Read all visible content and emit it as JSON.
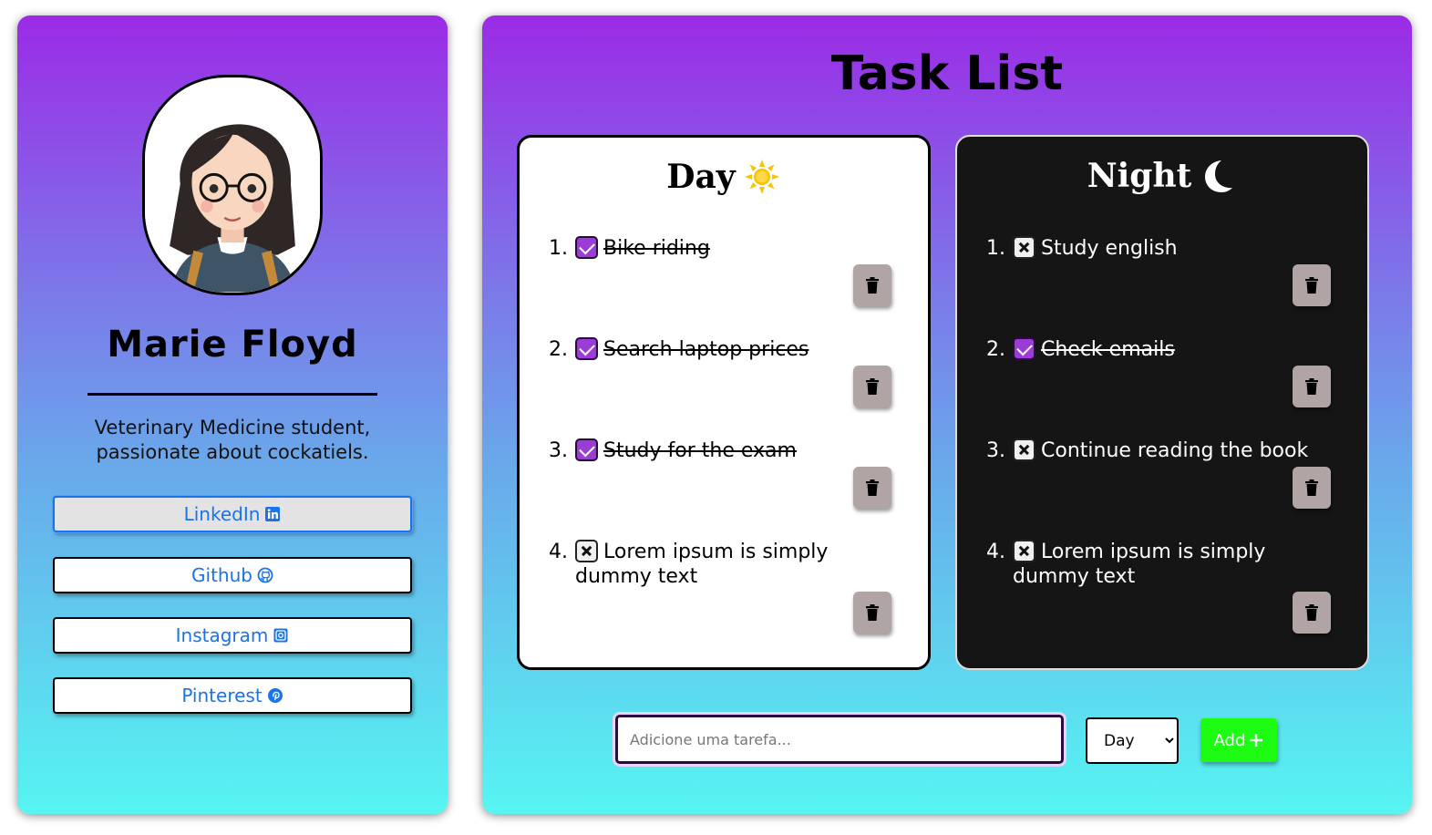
{
  "profile": {
    "name": "Marie Floyd",
    "bio_line1": "Veterinary Medicine student,",
    "bio_line2": "passionate about cockatiels.",
    "links": [
      {
        "label": "LinkedIn",
        "icon": "linkedin-icon"
      },
      {
        "label": "Github",
        "icon": "github-icon"
      },
      {
        "label": "Instagram",
        "icon": "instagram-icon"
      },
      {
        "label": "Pinterest",
        "icon": "pinterest-icon"
      }
    ]
  },
  "task_list": {
    "title": "Task List",
    "day": {
      "title": "Day",
      "icon": "sun-icon",
      "tasks": [
        {
          "num": "1.",
          "text": "Bike riding",
          "done": true
        },
        {
          "num": "2.",
          "text": "Search laptop prices",
          "done": true
        },
        {
          "num": "3.",
          "text": "Study for the exam",
          "done": true
        },
        {
          "num": "4.",
          "text": "Lorem ipsum is simply dummy text",
          "done": false
        }
      ]
    },
    "night": {
      "title": "Night",
      "icon": "moon-icon",
      "tasks": [
        {
          "num": "1.",
          "text": "Study english",
          "done": false
        },
        {
          "num": "2.",
          "text": "Check emails",
          "done": true
        },
        {
          "num": "3.",
          "text": "Continue reading the book",
          "done": false
        },
        {
          "num": "4.",
          "text": "Lorem ipsum is simply dummy text",
          "done": false
        }
      ]
    }
  },
  "add_form": {
    "placeholder": "Adicione uma tarefa...",
    "input_value": "",
    "period_selected": "Day",
    "add_label": "Add"
  },
  "colors": {
    "gradient_top": "#9b2be6",
    "gradient_bottom": "#56f5f2",
    "check_on": "#9b3cd6",
    "add_button": "#1dfc12",
    "link_text": "#1a73e8"
  }
}
